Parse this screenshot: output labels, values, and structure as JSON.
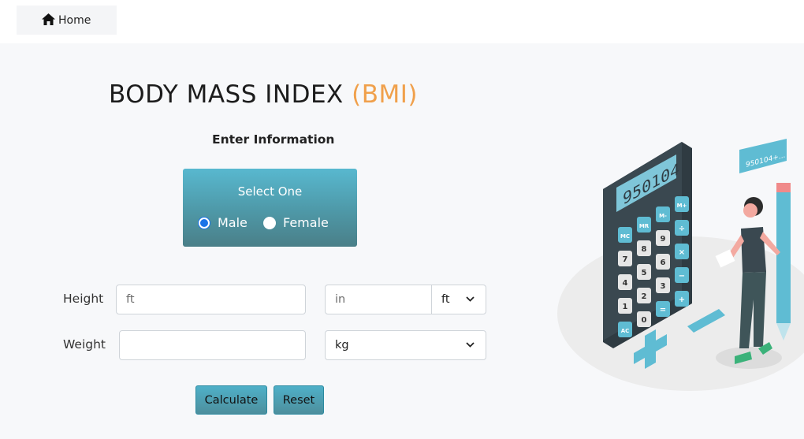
{
  "nav": {
    "home_label": "Home"
  },
  "header": {
    "title_main": "BODY MASS INDEX ",
    "title_accent": "(BMI)",
    "subtitle": "Enter Information"
  },
  "gender": {
    "prompt": "Select One",
    "options": [
      {
        "label": "Male",
        "selected": true
      },
      {
        "label": "Female",
        "selected": false
      }
    ]
  },
  "form": {
    "height_label": "Height",
    "height_primary_placeholder": "ft",
    "height_secondary_placeholder": "in",
    "height_unit": "ft",
    "weight_label": "Weight",
    "weight_value": "",
    "weight_unit": "kg"
  },
  "actions": {
    "calculate_label": "Calculate",
    "reset_label": "Reset"
  },
  "illustration": {
    "display_text": "950104",
    "bubble_text": "950104+...",
    "keys": [
      "MC",
      "MR",
      "M-",
      "M+",
      "7",
      "8",
      "9",
      "÷",
      "4",
      "5",
      "6",
      "×",
      "1",
      "2",
      "3",
      "−",
      "AC",
      "0",
      "=",
      "+"
    ]
  },
  "colors": {
    "accent": "#f0a04b",
    "teal": "#4fb0c8",
    "radio": "#1a73e8"
  }
}
